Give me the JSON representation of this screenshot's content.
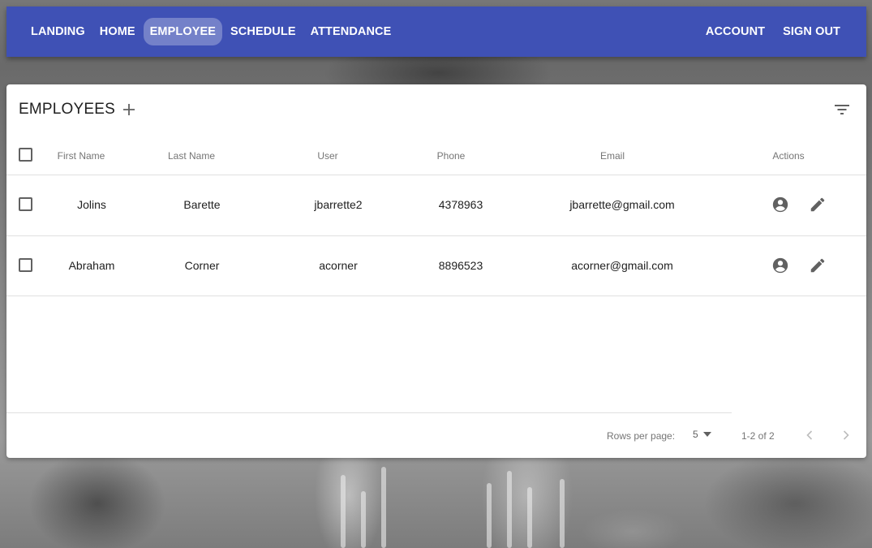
{
  "nav": {
    "left": [
      {
        "label": "LANDING",
        "active": false
      },
      {
        "label": "HOME",
        "active": false
      },
      {
        "label": "EMPLOYEE",
        "active": true
      },
      {
        "label": "SCHEDULE",
        "active": false
      },
      {
        "label": "ATTENDANCE",
        "active": false
      }
    ],
    "right": [
      {
        "label": "ACCOUNT"
      },
      {
        "label": "SIGN OUT"
      }
    ]
  },
  "colors": {
    "appbar": "#3f51b5",
    "icon": "#616161"
  },
  "table": {
    "title": "EMPLOYEES",
    "icons": {
      "add": "plus-icon",
      "filter": "filter-list-icon",
      "profile": "account-circle-icon",
      "edit": "pencil-icon"
    },
    "columns": [
      "First Name",
      "Last Name",
      "User",
      "Phone",
      "Email",
      "Actions"
    ],
    "rows": [
      {
        "first": "Jolins",
        "last": "Barette",
        "user": "jbarrette2",
        "phone": "4378963",
        "email": "jbarrette@gmail.com"
      },
      {
        "first": "Abraham",
        "last": "Corner",
        "user": "acorner",
        "phone": "8896523",
        "email": "acorner@gmail.com"
      }
    ]
  },
  "pagination": {
    "rows_per_page_label": "Rows per page:",
    "rows_per_page_value": "5",
    "range": "1-2 of 2"
  }
}
